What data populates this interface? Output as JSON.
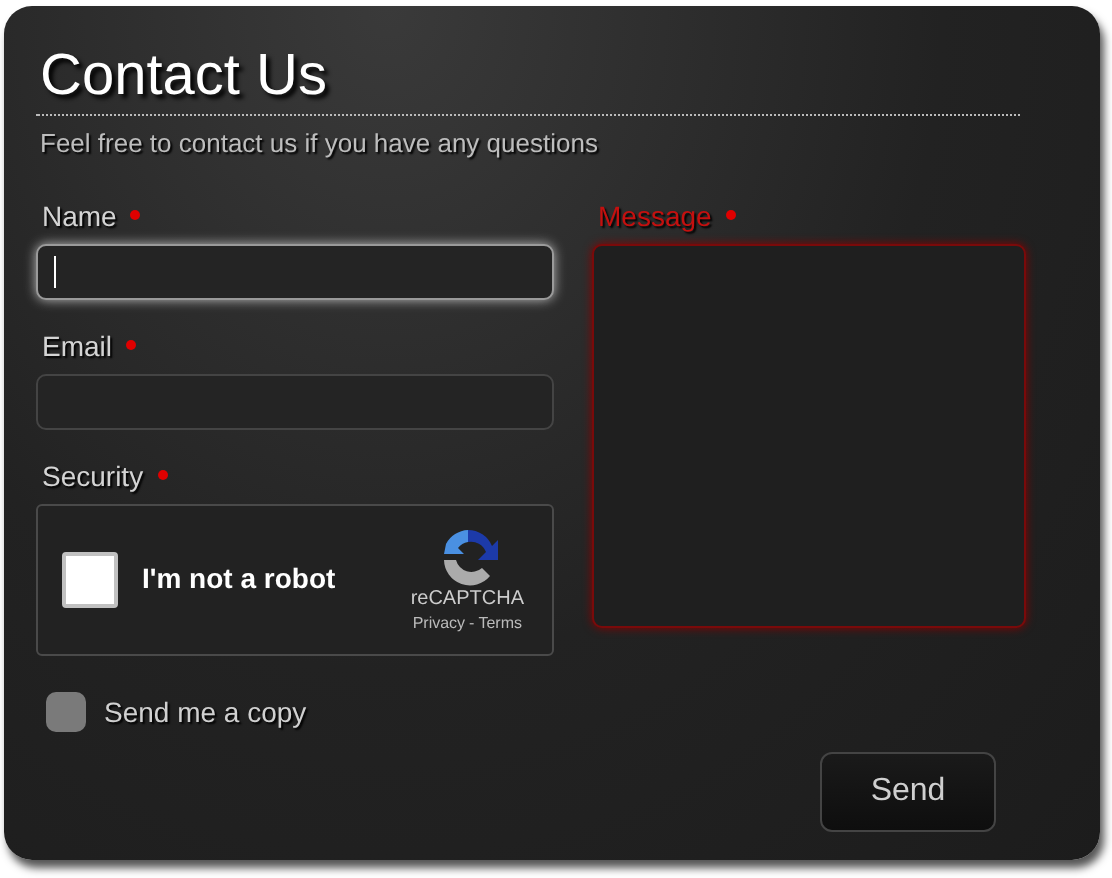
{
  "title": "Contact Us",
  "subtitle": "Feel free to contact us if you have any questions",
  "fields": [
    {
      "kind": "input",
      "label": "Name",
      "required": true,
      "focused": true,
      "error": false
    },
    {
      "kind": "input",
      "label": "Email",
      "required": true,
      "focused": false,
      "error": false
    },
    {
      "kind": "captcha",
      "label": "Security",
      "required": true,
      "checkbox_label": "I'm not a robot",
      "checked": false,
      "error": false,
      "brand": "reCAPTCHA",
      "links": [
        "Privacy",
        "Terms"
      ],
      "separator": "-"
    }
  ],
  "message": {
    "label": "Message",
    "required": true,
    "error": true
  },
  "copy": {
    "label": "Send me a copy",
    "checked": false
  },
  "send_button": "Send"
}
